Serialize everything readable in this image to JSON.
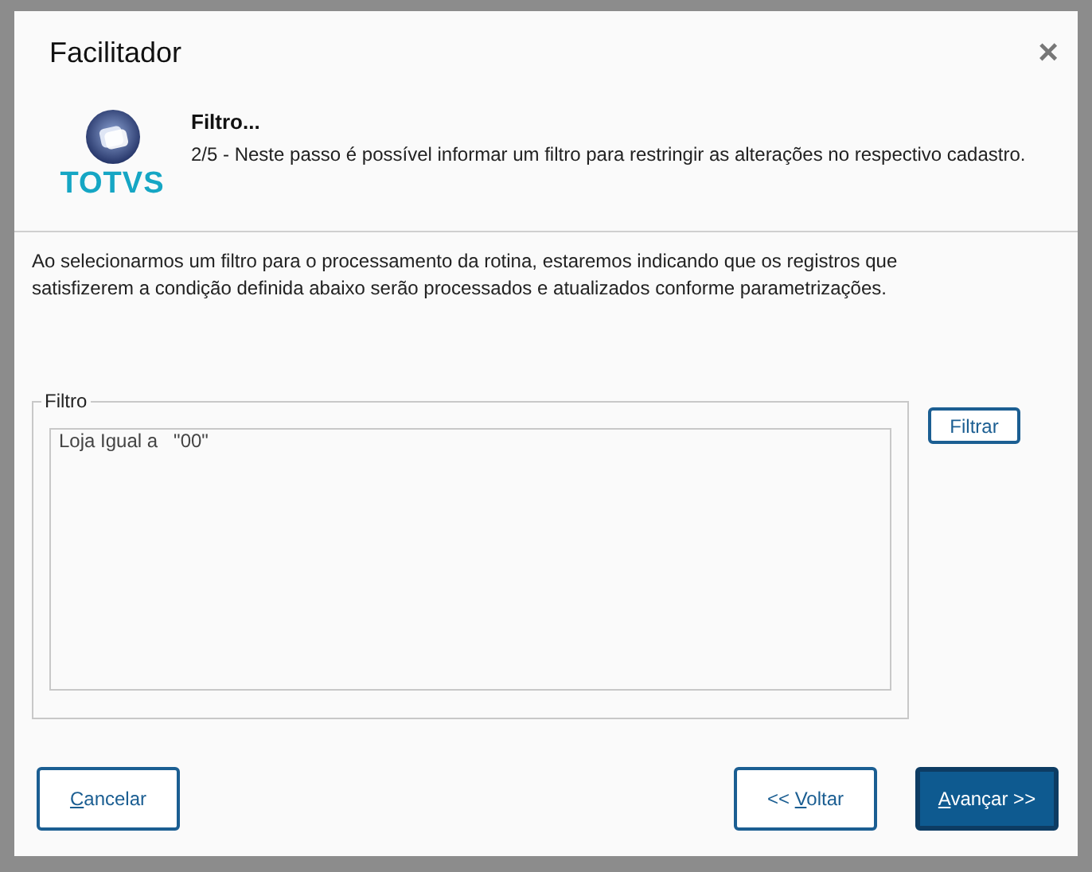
{
  "window": {
    "title": "Facilitador",
    "close": "×"
  },
  "header": {
    "logo_text": "TOTVS",
    "heading": "Filtro...",
    "description": "2/5 - Neste passo é possível informar um filtro para restringir as alterações no respectivo cadastro."
  },
  "intro": "Ao selecionarmos um filtro para o processamento da rotina, estaremos indicando que os registros que satisfizerem a condição definida abaixo serão processados e atualizados conforme parametrizações.",
  "filter": {
    "legend": "Filtro",
    "lines": [
      "Loja Igual a   \"00\""
    ],
    "button": "Filtrar"
  },
  "buttons": [
    {
      "kind": "secondary",
      "key": "C",
      "after": "ancelar"
    },
    {
      "kind": "secondary",
      "before": "<< ",
      "key": "V",
      "after": "oltar"
    },
    {
      "kind": "primary",
      "key": "A",
      "after": "vançar >>"
    }
  ]
}
